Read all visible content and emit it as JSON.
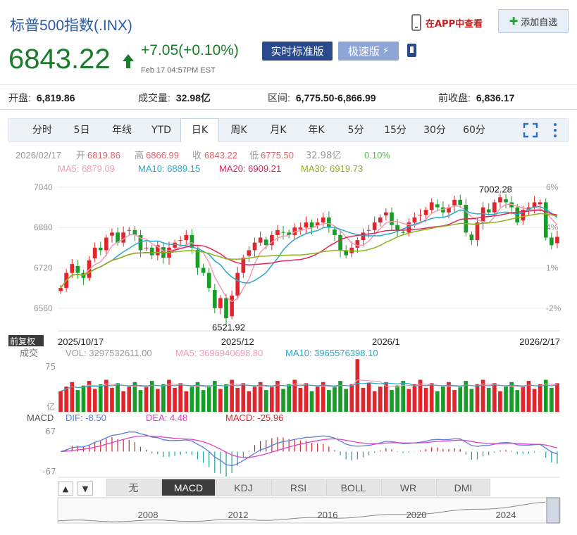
{
  "header": {
    "title": "标普500指数(.INX)",
    "app_link": "在APP中查看",
    "watchlist_button": "添加自选",
    "price": "6843.22",
    "change": "+7.05(+0.10%)",
    "time": "Feb 17 04:57PM EST",
    "realtime_button": "实时标准版",
    "fast_button": "极速版",
    "colors": {
      "up": "#e0262c",
      "down": "#1a9c2a",
      "accent": "#2b4a8c"
    }
  },
  "stats": [
    {
      "label": "开盘:",
      "value": "6,819.86"
    },
    {
      "label": "成交量:",
      "value": "32.98亿"
    },
    {
      "label": "区间:",
      "value": "6,775.50-6,866.99"
    },
    {
      "label": "前收盘:",
      "value": "6,836.17"
    }
  ],
  "tabs": [
    "分时",
    "5日",
    "年线",
    "YTD",
    "日K",
    "周K",
    "月K",
    "年K",
    "5分",
    "15分",
    "30分",
    "60分"
  ],
  "active_tab": "日K",
  "indicator_tabs": [
    "无",
    "MACD",
    "KDJ",
    "RSI",
    "BOLL",
    "WR",
    "DMI"
  ],
  "active_indicator": "MACD",
  "chart_data": {
    "type": "candlestick",
    "info_line": {
      "date": "2026/02/17",
      "open_label": "开",
      "open": "6819.86",
      "high_label": "高",
      "high": "6866.99",
      "close_label": "收",
      "close": "6843.22",
      "low_label": "低",
      "low": "6775.50",
      "vol": "32.98亿",
      "pct": "0.10%"
    },
    "ma_legend": [
      {
        "name": "MA5",
        "value": "6879.09",
        "color": "#f29cb4"
      },
      {
        "name": "MA10",
        "value": "6889.15",
        "color": "#27a9c8"
      },
      {
        "name": "MA20",
        "value": "6909.21",
        "color": "#e0265a"
      },
      {
        "name": "MA30",
        "value": "6919.73",
        "color": "#8ab31e"
      }
    ],
    "y_ticks": [
      "7040",
      "6880",
      "6720",
      "6560"
    ],
    "y_tick_values": [
      7040,
      6880,
      6720,
      6560
    ],
    "ylim": [
      6470,
      7090
    ],
    "pct_ticks": [
      "6%",
      "4%",
      "1%",
      "-2%"
    ],
    "pct_tick_values": [
      7040,
      6880,
      6720,
      6560
    ],
    "x_labels": [
      "2025/10/17",
      "2025/12",
      "2026/1",
      "2026/2/17"
    ],
    "x_label_index": [
      0,
      31,
      57,
      87
    ],
    "max_label": "7002.28",
    "min_label": "6521.92",
    "max_value": 7002.28,
    "min_value": 6521.92,
    "adjust_label": "前复权",
    "closes": [
      6640,
      6700,
      6735,
      6700,
      6680,
      6750,
      6800,
      6790,
      6840,
      6860,
      6820,
      6860,
      6870,
      6850,
      6790,
      6800,
      6770,
      6810,
      6760,
      6800,
      6820,
      6830,
      6850,
      6800,
      6720,
      6700,
      6640,
      6560,
      6600,
      6520,
      6610,
      6700,
      6760,
      6790,
      6820,
      6840,
      6810,
      6850,
      6870,
      6860,
      6850,
      6880,
      6880,
      6900,
      6880,
      6900,
      6920,
      6880,
      6850,
      6790,
      6770,
      6800,
      6830,
      6860,
      6870,
      6900,
      6920,
      6940,
      6890,
      6870,
      6860,
      6900,
      6920,
      6930,
      6950,
      6980,
      6960,
      6940,
      6960,
      6990,
      6970,
      6860,
      6830,
      6900,
      6960,
      6940,
      6980,
      7000,
      6980,
      6960,
      6900,
      6950,
      6960,
      6980,
      6980,
      6840,
      6810,
      6843
    ],
    "volume": {
      "label": "成交",
      "vol_text": "VOL: 3297532611.00",
      "ma5_text": "MA5: 3696940698.80",
      "ma10_text": "MA10: 3965576398.10",
      "top_tick": "75",
      "bottom_tick": "亿"
    },
    "macd": {
      "label": "MACD",
      "dif_text": "DIF: -8.50",
      "dea_text": "DEA: 4.48",
      "macd_text": "MACD: -25.96",
      "top_tick": "67",
      "bottom_tick": "-67"
    },
    "navigator_years": [
      "2008",
      "2012",
      "2016",
      "2020",
      "2024"
    ]
  }
}
